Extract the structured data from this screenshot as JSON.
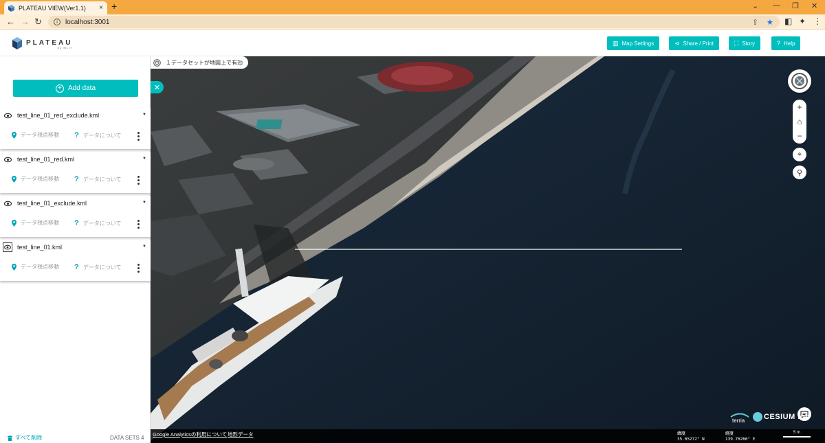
{
  "browser": {
    "tab_title": "PLATEAU VIEW(Ver1.1)",
    "tab_close": "×",
    "new_tab": "+",
    "url": "localhost:3001",
    "window_controls": [
      "⌄",
      "—",
      "❐",
      "✕"
    ]
  },
  "header": {
    "logo_text": "PLATEAU",
    "logo_sub": "by MLIT",
    "buttons": {
      "map_settings": "Map Settings",
      "share_print": "Share / Print",
      "story": "Story",
      "help": "Help"
    }
  },
  "sidebar": {
    "add_data_label": "Add data",
    "datasets": [
      {
        "name": "test_line_01_red_exclude.kml",
        "move_label": "データ視点移動",
        "about_label": "データについて"
      },
      {
        "name": "test_line_01_red.kml",
        "move_label": "データ視点移動",
        "about_label": "データについて"
      },
      {
        "name": "test_line_01_exclude.kml",
        "move_label": "データ視点移動",
        "about_label": "データについて"
      },
      {
        "name": "test_line_01.kml",
        "move_label": "データ視点移動",
        "about_label": "データについて"
      }
    ],
    "delete_all_label": "すべて削除",
    "dataset_count_label": "DATA SETS 4"
  },
  "map": {
    "status_text": "１データセットが地図上で有効",
    "close_panel": "✕",
    "zoom_in": "+",
    "zoom_out": "−",
    "credits": {
      "analytics_link": "Google Analyticsの利用について",
      "terrain_link": "地形データ"
    },
    "coords": {
      "lat_label": "緯度",
      "lat_value": "35.65272° N",
      "lon_label": "経度",
      "lon_value": "139.76266° E"
    },
    "scale_label": "5 m",
    "terria_label": "terria",
    "cesium_label": "CESIUM ion"
  },
  "colors": {
    "accent": "#00bebe",
    "tab_bar": "#f5a83f",
    "toolbar": "#fdefd8"
  }
}
